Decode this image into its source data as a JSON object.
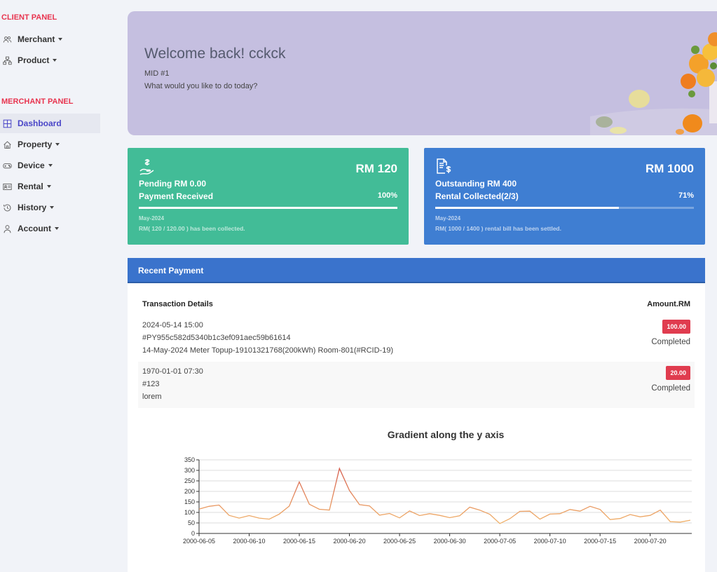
{
  "sidebar": {
    "client_panel_title": "CLIENT PANEL",
    "merchant_panel_title": "MERCHANT PANEL",
    "client_items": [
      {
        "label": "Merchant",
        "icon": "users-icon"
      },
      {
        "label": "Product",
        "icon": "sitemap-icon"
      }
    ],
    "merchant_items": [
      {
        "label": "Dashboard",
        "icon": "grid-icon",
        "active": true
      },
      {
        "label": "Property",
        "icon": "home-icon"
      },
      {
        "label": "Device",
        "icon": "gamepad-icon"
      },
      {
        "label": "Rental",
        "icon": "id-card-icon"
      },
      {
        "label": "History",
        "icon": "history-icon"
      },
      {
        "label": "Account",
        "icon": "user-icon"
      }
    ]
  },
  "banner": {
    "welcome": "Welcome back! cckck",
    "mid": "MID #1",
    "question": "What would you like to do today?"
  },
  "cards": {
    "payment": {
      "amount": "RM 120",
      "line1": "Pending RM 0.00",
      "line2": "Payment Received",
      "percent_label": "100%",
      "progress": 1.0,
      "month": "May-2024",
      "note": "RM( 120 / 120.00 ) has been collected.",
      "color": "#42bc97"
    },
    "rental": {
      "amount": "RM 1000",
      "line1": "Outstanding RM 400",
      "line2": "Rental Collected(2/3)",
      "percent_label": "71%",
      "progress": 0.71,
      "month": "May-2024",
      "note": "RM( 1000 / 1400 ) rental bill has been settled.",
      "color": "#3f7ed2"
    }
  },
  "recent_payment": {
    "title": "Recent Payment",
    "col_details": "Transaction Details",
    "col_amount": "Amount.RM",
    "rows": [
      {
        "datetime": "2024-05-14 15:00",
        "ref": "#PY955c582d5340b1c3ef091aec59b61614",
        "desc": "14-May-2024 Meter Topup-19101321768(200kWh) Room-801(#RCID-19)",
        "amount": "100.00",
        "status": "Completed"
      },
      {
        "datetime": "1970-01-01 07:30",
        "ref": "#123",
        "desc": "lorem",
        "amount": "20.00",
        "status": "Completed"
      }
    ]
  },
  "chart_data": {
    "type": "line",
    "title": "Gradient along the y axis",
    "xlabel": "",
    "ylabel": "",
    "ylim": [
      0,
      350
    ],
    "yticks": [
      0,
      50,
      100,
      150,
      200,
      250,
      300,
      350
    ],
    "xtick_labels": [
      "2000-06-05",
      "2000-06-10",
      "2000-06-15",
      "2000-06-20",
      "2000-06-25",
      "2000-06-30",
      "2000-07-05",
      "2000-07-10",
      "2000-07-15",
      "2000-07-20"
    ],
    "x_start": "2000-06-05",
    "x": [
      "2000-06-05",
      "2000-06-06",
      "2000-06-07",
      "2000-06-08",
      "2000-06-09",
      "2000-06-10",
      "2000-06-11",
      "2000-06-12",
      "2000-06-13",
      "2000-06-14",
      "2000-06-15",
      "2000-06-16",
      "2000-06-17",
      "2000-06-18",
      "2000-06-19",
      "2000-06-20",
      "2000-06-21",
      "2000-06-22",
      "2000-06-23",
      "2000-06-24",
      "2000-06-25",
      "2000-06-26",
      "2000-06-27",
      "2000-06-28",
      "2000-06-29",
      "2000-06-30",
      "2000-07-01",
      "2000-07-02",
      "2000-07-03",
      "2000-07-04",
      "2000-07-05",
      "2000-07-06",
      "2000-07-07",
      "2000-07-08",
      "2000-07-09",
      "2000-07-10",
      "2000-07-11",
      "2000-07-12",
      "2000-07-13",
      "2000-07-14",
      "2000-07-15",
      "2000-07-16",
      "2000-07-17",
      "2000-07-18",
      "2000-07-19",
      "2000-07-20",
      "2000-07-21",
      "2000-07-22",
      "2000-07-23",
      "2000-07-24"
    ],
    "values": [
      116,
      129,
      135,
      86,
      73,
      85,
      73,
      68,
      92,
      130,
      245,
      139,
      115,
      111,
      309,
      204,
      137,
      131,
      87,
      95,
      74,
      107,
      85,
      94,
      86,
      75,
      84,
      125,
      111,
      91,
      47,
      70,
      105,
      106,
      68,
      92,
      94,
      114,
      106,
      129,
      114,
      66,
      71,
      90,
      79,
      86,
      111,
      56,
      54,
      63
    ],
    "grid": true,
    "gradient_colors": [
      "#f6c36f",
      "#d2504a"
    ]
  }
}
